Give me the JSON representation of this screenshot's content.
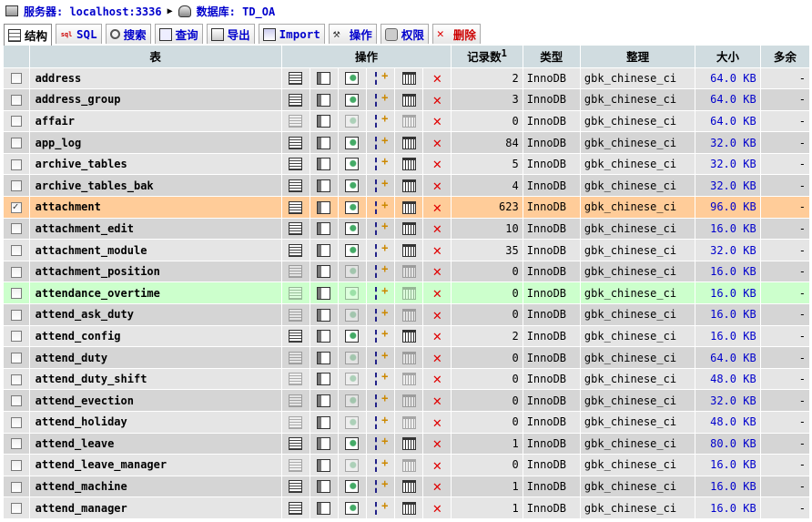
{
  "breadcrumb": {
    "server_label": "服务器: localhost:3336",
    "db_label": "数据库: TD_OA"
  },
  "tabs": [
    {
      "label": "结构",
      "icon": "structure-icon",
      "active": true
    },
    {
      "label": "SQL",
      "icon": "sql-icon"
    },
    {
      "label": "搜索",
      "icon": "search-icon"
    },
    {
      "label": "查询",
      "icon": "query-icon"
    },
    {
      "label": "导出",
      "icon": "export-icon"
    },
    {
      "label": "Import",
      "icon": "import-icon"
    },
    {
      "label": "操作",
      "icon": "operations-icon"
    },
    {
      "label": "权限",
      "icon": "privileges-icon"
    },
    {
      "label": "删除",
      "icon": "drop-icon",
      "danger": true
    }
  ],
  "table": {
    "headers": {
      "table": "表",
      "action": "操作",
      "records": "记录数",
      "records_sup": "1",
      "type": "类型",
      "collation": "整理",
      "size": "大小",
      "overhead": "多余"
    },
    "action_icons": [
      "browse-icon",
      "structure-icon",
      "search-icon",
      "insert-icon",
      "empty-icon",
      "drop-icon"
    ],
    "rows": [
      {
        "name": "address",
        "records": "2",
        "type": "InnoDB",
        "collation": "gbk_chinese_ci",
        "size": "64.0 KB",
        "overhead": "-",
        "empty": false
      },
      {
        "name": "address_group",
        "records": "3",
        "type": "InnoDB",
        "collation": "gbk_chinese_ci",
        "size": "64.0 KB",
        "overhead": "-",
        "empty": false
      },
      {
        "name": "affair",
        "records": "0",
        "type": "InnoDB",
        "collation": "gbk_chinese_ci",
        "size": "64.0 KB",
        "overhead": "-",
        "empty": true
      },
      {
        "name": "app_log",
        "records": "84",
        "type": "InnoDB",
        "collation": "gbk_chinese_ci",
        "size": "32.0 KB",
        "overhead": "-",
        "empty": false
      },
      {
        "name": "archive_tables",
        "records": "5",
        "type": "InnoDB",
        "collation": "gbk_chinese_ci",
        "size": "32.0 KB",
        "overhead": "-",
        "empty": false
      },
      {
        "name": "archive_tables_bak",
        "records": "4",
        "type": "InnoDB",
        "collation": "gbk_chinese_ci",
        "size": "32.0 KB",
        "overhead": "-",
        "empty": false
      },
      {
        "name": "attachment",
        "records": "623",
        "type": "InnoDB",
        "collation": "gbk_chinese_ci",
        "size": "96.0 KB",
        "overhead": "-",
        "empty": false,
        "checked": true,
        "marked": true
      },
      {
        "name": "attachment_edit",
        "records": "10",
        "type": "InnoDB",
        "collation": "gbk_chinese_ci",
        "size": "16.0 KB",
        "overhead": "-",
        "empty": false
      },
      {
        "name": "attachment_module",
        "records": "35",
        "type": "InnoDB",
        "collation": "gbk_chinese_ci",
        "size": "32.0 KB",
        "overhead": "-",
        "empty": false
      },
      {
        "name": "attachment_position",
        "records": "0",
        "type": "InnoDB",
        "collation": "gbk_chinese_ci",
        "size": "16.0 KB",
        "overhead": "-",
        "empty": true
      },
      {
        "name": "attendance_overtime",
        "records": "0",
        "type": "InnoDB",
        "collation": "gbk_chinese_ci",
        "size": "16.0 KB",
        "overhead": "-",
        "empty": true,
        "hover": true
      },
      {
        "name": "attend_ask_duty",
        "records": "0",
        "type": "InnoDB",
        "collation": "gbk_chinese_ci",
        "size": "16.0 KB",
        "overhead": "-",
        "empty": true
      },
      {
        "name": "attend_config",
        "records": "2",
        "type": "InnoDB",
        "collation": "gbk_chinese_ci",
        "size": "16.0 KB",
        "overhead": "-",
        "empty": false
      },
      {
        "name": "attend_duty",
        "records": "0",
        "type": "InnoDB",
        "collation": "gbk_chinese_ci",
        "size": "64.0 KB",
        "overhead": "-",
        "empty": true
      },
      {
        "name": "attend_duty_shift",
        "records": "0",
        "type": "InnoDB",
        "collation": "gbk_chinese_ci",
        "size": "48.0 KB",
        "overhead": "-",
        "empty": true
      },
      {
        "name": "attend_evection",
        "records": "0",
        "type": "InnoDB",
        "collation": "gbk_chinese_ci",
        "size": "32.0 KB",
        "overhead": "-",
        "empty": true
      },
      {
        "name": "attend_holiday",
        "records": "0",
        "type": "InnoDB",
        "collation": "gbk_chinese_ci",
        "size": "48.0 KB",
        "overhead": "-",
        "empty": true
      },
      {
        "name": "attend_leave",
        "records": "1",
        "type": "InnoDB",
        "collation": "gbk_chinese_ci",
        "size": "80.0 KB",
        "overhead": "-",
        "empty": false
      },
      {
        "name": "attend_leave_manager",
        "records": "0",
        "type": "InnoDB",
        "collation": "gbk_chinese_ci",
        "size": "16.0 KB",
        "overhead": "-",
        "empty": true
      },
      {
        "name": "attend_machine",
        "records": "1",
        "type": "InnoDB",
        "collation": "gbk_chinese_ci",
        "size": "16.0 KB",
        "overhead": "-",
        "empty": false
      },
      {
        "name": "attend_manager",
        "records": "1",
        "type": "InnoDB",
        "collation": "gbk_chinese_ci",
        "size": "16.0 KB",
        "overhead": "-",
        "empty": false
      }
    ]
  }
}
